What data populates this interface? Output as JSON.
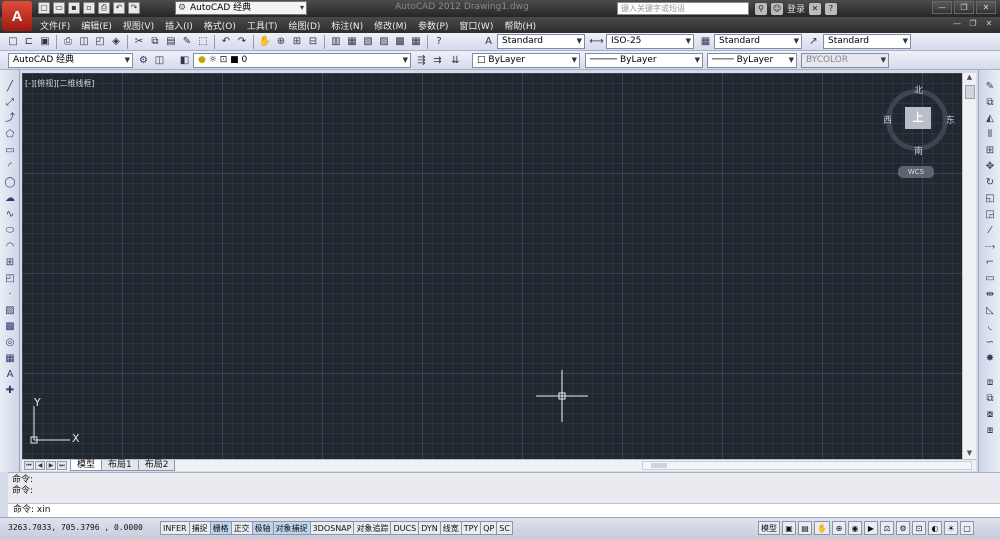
{
  "window": {
    "app_logo": "A",
    "workspace": "AutoCAD 经典",
    "title": "AutoCAD 2012    Drawing1.dwg",
    "search_placeholder": "键入关键字或短语",
    "login": "登录"
  },
  "menu": {
    "items": [
      "文件(F)",
      "编辑(E)",
      "视图(V)",
      "插入(I)",
      "格式(O)",
      "工具(T)",
      "绘图(D)",
      "标注(N)",
      "修改(M)",
      "参数(P)",
      "窗口(W)",
      "帮助(H)"
    ]
  },
  "styles_toolbar": {
    "text_style": "Standard",
    "dim_style": "ISO-25",
    "table_style": "Standard",
    "mleader_style": "Standard"
  },
  "layers_toolbar": {
    "workspace": "AutoCAD 经典",
    "current_layer": "0",
    "color": "ByLayer",
    "linetype": "ByLayer",
    "lineweight": "ByLayer",
    "plot_style": "BYCOLOR"
  },
  "viewport": {
    "label": "[-][俯视][二维线框]",
    "viewcube": {
      "face": "上",
      "north": "北",
      "south": "南",
      "east": "东",
      "west": "西"
    },
    "wcs": "WCS",
    "ucs_x": "X",
    "ucs_y": "Y"
  },
  "layout_tabs": [
    "模型",
    "布局1",
    "布局2"
  ],
  "command": {
    "history": [
      "命令:",
      "命令:"
    ],
    "current": "命令: xin"
  },
  "status": {
    "coordinates": "3263.7033, 705.3796 , 0.0000",
    "toggles": [
      {
        "label": "INFER",
        "on": false
      },
      {
        "label": "捕捉",
        "on": false
      },
      {
        "label": "栅格",
        "on": true
      },
      {
        "label": "正交",
        "on": false
      },
      {
        "label": "极轴",
        "on": true
      },
      {
        "label": "对象捕捉",
        "on": true
      },
      {
        "label": "3DOSNAP",
        "on": false
      },
      {
        "label": "对象追踪",
        "on": false
      },
      {
        "label": "DUCS",
        "on": false
      },
      {
        "label": "DYN",
        "on": false
      },
      {
        "label": "线宽",
        "on": false
      },
      {
        "label": "TPY",
        "on": false
      },
      {
        "label": "QP",
        "on": false
      },
      {
        "label": "SC",
        "on": false
      }
    ],
    "model_label": "模型"
  },
  "colors": {
    "canvas_bg": "#212830",
    "titlebar_bg": "#2e2e2e",
    "toolbar_bg": "#dfe4f0"
  }
}
